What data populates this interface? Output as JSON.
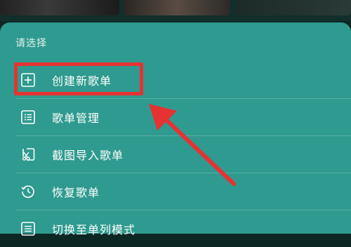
{
  "sheet": {
    "title": "请选择",
    "items": [
      {
        "label": "创建新歌单",
        "icon": "plus-square-icon"
      },
      {
        "label": "歌单管理",
        "icon": "list-manage-icon"
      },
      {
        "label": "截图导入歌单",
        "icon": "screenshot-import-icon"
      },
      {
        "label": "恢复歌单",
        "icon": "restore-clock-icon"
      },
      {
        "label": "切换至单列模式",
        "icon": "single-column-icon"
      }
    ]
  },
  "annotation": {
    "highlight_color": "#e63232",
    "arrow_color": "#e63232"
  },
  "colors": {
    "sheet_background": "#2f9a8f",
    "page_background": "#0d2724"
  }
}
